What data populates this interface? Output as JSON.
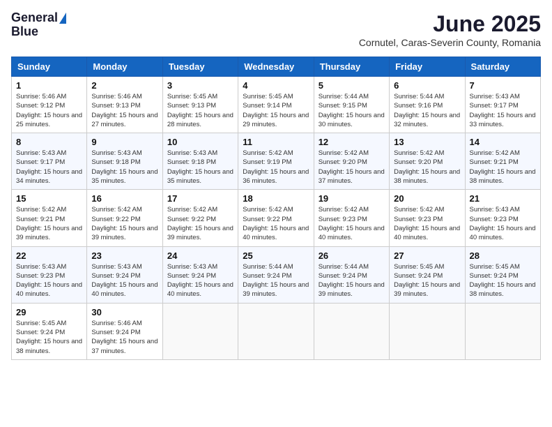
{
  "header": {
    "logo_line1": "General",
    "logo_line2": "Blue",
    "month": "June 2025",
    "location": "Cornutel, Caras-Severin County, Romania"
  },
  "days_of_week": [
    "Sunday",
    "Monday",
    "Tuesday",
    "Wednesday",
    "Thursday",
    "Friday",
    "Saturday"
  ],
  "weeks": [
    [
      {
        "day": "1",
        "sunrise": "5:46 AM",
        "sunset": "9:12 PM",
        "daylight": "15 hours and 25 minutes."
      },
      {
        "day": "2",
        "sunrise": "5:46 AM",
        "sunset": "9:13 PM",
        "daylight": "15 hours and 27 minutes."
      },
      {
        "day": "3",
        "sunrise": "5:45 AM",
        "sunset": "9:13 PM",
        "daylight": "15 hours and 28 minutes."
      },
      {
        "day": "4",
        "sunrise": "5:45 AM",
        "sunset": "9:14 PM",
        "daylight": "15 hours and 29 minutes."
      },
      {
        "day": "5",
        "sunrise": "5:44 AM",
        "sunset": "9:15 PM",
        "daylight": "15 hours and 30 minutes."
      },
      {
        "day": "6",
        "sunrise": "5:44 AM",
        "sunset": "9:16 PM",
        "daylight": "15 hours and 32 minutes."
      },
      {
        "day": "7",
        "sunrise": "5:43 AM",
        "sunset": "9:17 PM",
        "daylight": "15 hours and 33 minutes."
      }
    ],
    [
      {
        "day": "8",
        "sunrise": "5:43 AM",
        "sunset": "9:17 PM",
        "daylight": "15 hours and 34 minutes."
      },
      {
        "day": "9",
        "sunrise": "5:43 AM",
        "sunset": "9:18 PM",
        "daylight": "15 hours and 35 minutes."
      },
      {
        "day": "10",
        "sunrise": "5:43 AM",
        "sunset": "9:18 PM",
        "daylight": "15 hours and 35 minutes."
      },
      {
        "day": "11",
        "sunrise": "5:42 AM",
        "sunset": "9:19 PM",
        "daylight": "15 hours and 36 minutes."
      },
      {
        "day": "12",
        "sunrise": "5:42 AM",
        "sunset": "9:20 PM",
        "daylight": "15 hours and 37 minutes."
      },
      {
        "day": "13",
        "sunrise": "5:42 AM",
        "sunset": "9:20 PM",
        "daylight": "15 hours and 38 minutes."
      },
      {
        "day": "14",
        "sunrise": "5:42 AM",
        "sunset": "9:21 PM",
        "daylight": "15 hours and 38 minutes."
      }
    ],
    [
      {
        "day": "15",
        "sunrise": "5:42 AM",
        "sunset": "9:21 PM",
        "daylight": "15 hours and 39 minutes."
      },
      {
        "day": "16",
        "sunrise": "5:42 AM",
        "sunset": "9:22 PM",
        "daylight": "15 hours and 39 minutes."
      },
      {
        "day": "17",
        "sunrise": "5:42 AM",
        "sunset": "9:22 PM",
        "daylight": "15 hours and 39 minutes."
      },
      {
        "day": "18",
        "sunrise": "5:42 AM",
        "sunset": "9:22 PM",
        "daylight": "15 hours and 40 minutes."
      },
      {
        "day": "19",
        "sunrise": "5:42 AM",
        "sunset": "9:23 PM",
        "daylight": "15 hours and 40 minutes."
      },
      {
        "day": "20",
        "sunrise": "5:42 AM",
        "sunset": "9:23 PM",
        "daylight": "15 hours and 40 minutes."
      },
      {
        "day": "21",
        "sunrise": "5:43 AM",
        "sunset": "9:23 PM",
        "daylight": "15 hours and 40 minutes."
      }
    ],
    [
      {
        "day": "22",
        "sunrise": "5:43 AM",
        "sunset": "9:23 PM",
        "daylight": "15 hours and 40 minutes."
      },
      {
        "day": "23",
        "sunrise": "5:43 AM",
        "sunset": "9:24 PM",
        "daylight": "15 hours and 40 minutes."
      },
      {
        "day": "24",
        "sunrise": "5:43 AM",
        "sunset": "9:24 PM",
        "daylight": "15 hours and 40 minutes."
      },
      {
        "day": "25",
        "sunrise": "5:44 AM",
        "sunset": "9:24 PM",
        "daylight": "15 hours and 39 minutes."
      },
      {
        "day": "26",
        "sunrise": "5:44 AM",
        "sunset": "9:24 PM",
        "daylight": "15 hours and 39 minutes."
      },
      {
        "day": "27",
        "sunrise": "5:45 AM",
        "sunset": "9:24 PM",
        "daylight": "15 hours and 39 minutes."
      },
      {
        "day": "28",
        "sunrise": "5:45 AM",
        "sunset": "9:24 PM",
        "daylight": "15 hours and 38 minutes."
      }
    ],
    [
      {
        "day": "29",
        "sunrise": "5:45 AM",
        "sunset": "9:24 PM",
        "daylight": "15 hours and 38 minutes."
      },
      {
        "day": "30",
        "sunrise": "5:46 AM",
        "sunset": "9:24 PM",
        "daylight": "15 hours and 37 minutes."
      },
      null,
      null,
      null,
      null,
      null
    ]
  ],
  "labels": {
    "sunrise_prefix": "Sunrise: ",
    "sunset_prefix": "Sunset: ",
    "daylight_prefix": "Daylight: "
  }
}
